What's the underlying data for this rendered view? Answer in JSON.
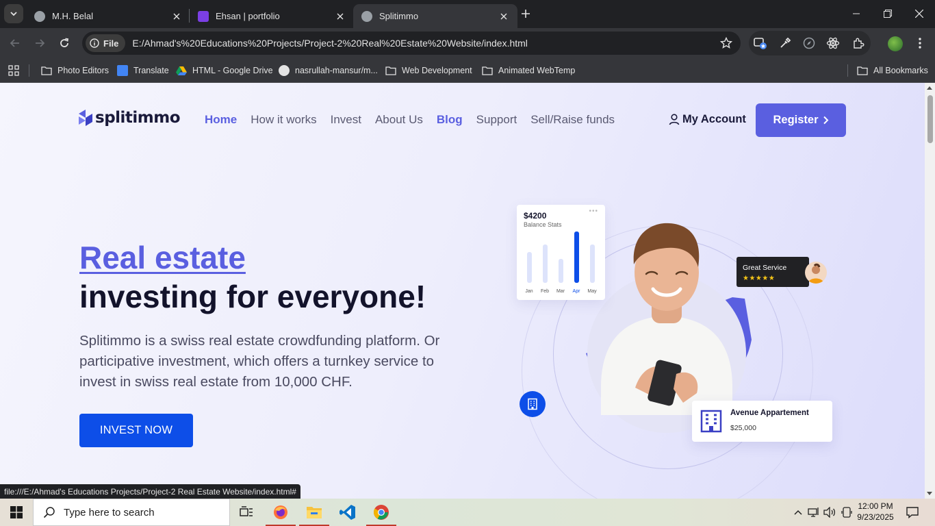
{
  "browser": {
    "tabs": [
      {
        "title": "M.H. Belal",
        "active": false
      },
      {
        "title": "Ehsan | portfolio",
        "active": false
      },
      {
        "title": "Splitimmo",
        "active": true
      }
    ],
    "site_chip": "File",
    "url": "E:/Ahmad's%20Educations%20Projects/Project-2%20Real%20Estate%20Website/index.html",
    "bookmarks": [
      "Photo Editors",
      "Translate",
      "HTML - Google Drive",
      "nasrullah-mansur/m...",
      "Web Development",
      "Animated WebTemp"
    ],
    "all_bookmarks": "All Bookmarks",
    "status_url": "file:///E:/Ahmad's Educations Projects/Project-2 Real Estate Website/index.html#"
  },
  "page": {
    "logo": "splitimmo",
    "nav": [
      {
        "label": "Home",
        "highlight": true
      },
      {
        "label": "How it works",
        "highlight": false
      },
      {
        "label": "Invest",
        "highlight": false
      },
      {
        "label": "About Us",
        "highlight": false
      },
      {
        "label": "Blog",
        "highlight": true
      },
      {
        "label": "Support",
        "highlight": false
      },
      {
        "label": "Sell/Raise funds",
        "highlight": false
      }
    ],
    "account": "My Account",
    "register": "Register",
    "hero": {
      "title_accent": "Real estate",
      "title_main": "investing for everyone!",
      "description": "Splitimmo is a swiss real estate crowdfunding platform. Or participative investment, which offers a turnkey service to invest in swiss real estate from 10,000 CHF.",
      "cta": "INVEST NOW"
    },
    "stats_card": {
      "amount": "$4200",
      "label": "Balance Stats",
      "months": [
        "Jan",
        "Feb",
        "Mar",
        "Apr",
        "May"
      ],
      "values": [
        0.6,
        0.75,
        0.47,
        1.0,
        0.74
      ],
      "highlight_index": 3
    },
    "review_card": {
      "title": "Great Service",
      "stars": "★★★★★"
    },
    "apartment_card": {
      "name": "Avenue Appartement",
      "price": "$25,000"
    },
    "colors": {
      "primary": "#5a5fe0",
      "cta": "#0d4ee8",
      "heading": "#13132b"
    }
  },
  "taskbar": {
    "search_placeholder": "Type here to search",
    "time": "12:00 PM",
    "date": "9/23/2025"
  }
}
